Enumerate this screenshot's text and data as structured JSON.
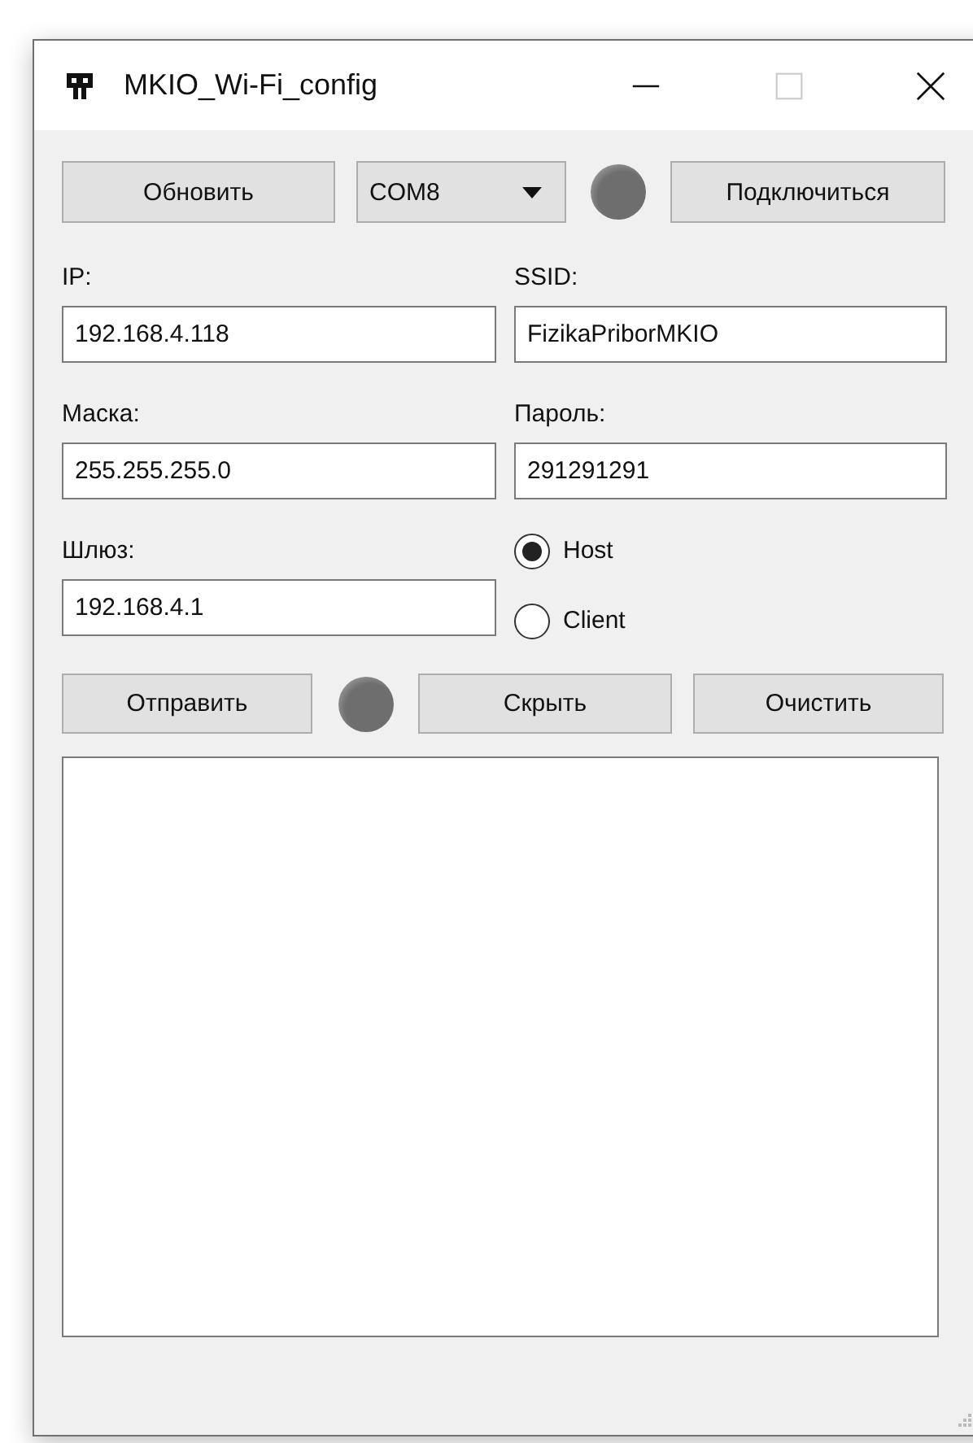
{
  "window": {
    "title": "MKIO_Wi-Fi_config"
  },
  "top_bar": {
    "refresh_button": "Обновить",
    "port_combo": {
      "value": "COM8"
    },
    "indicator": {
      "on": false
    },
    "connect_button": "Подключиться"
  },
  "form": {
    "left": [
      {
        "label": "IP:",
        "value": "192.168.4.118"
      },
      {
        "label": "Маска:",
        "value": "255.255.255.0"
      },
      {
        "label": "Шлюз:",
        "value": "192.168.4.1"
      }
    ],
    "right": [
      {
        "label": "SSID:",
        "value": "FizikaPriborMKIO"
      },
      {
        "label": "Пароль:",
        "value": "291291291"
      }
    ],
    "modes": [
      {
        "label": "Host",
        "selected": true
      },
      {
        "label": "Client",
        "selected": false
      }
    ]
  },
  "action_bar": {
    "send_button": "Отправить",
    "indicator": {
      "on": false
    },
    "hide_button": "Скрыть",
    "clear_button": "Очистить"
  }
}
